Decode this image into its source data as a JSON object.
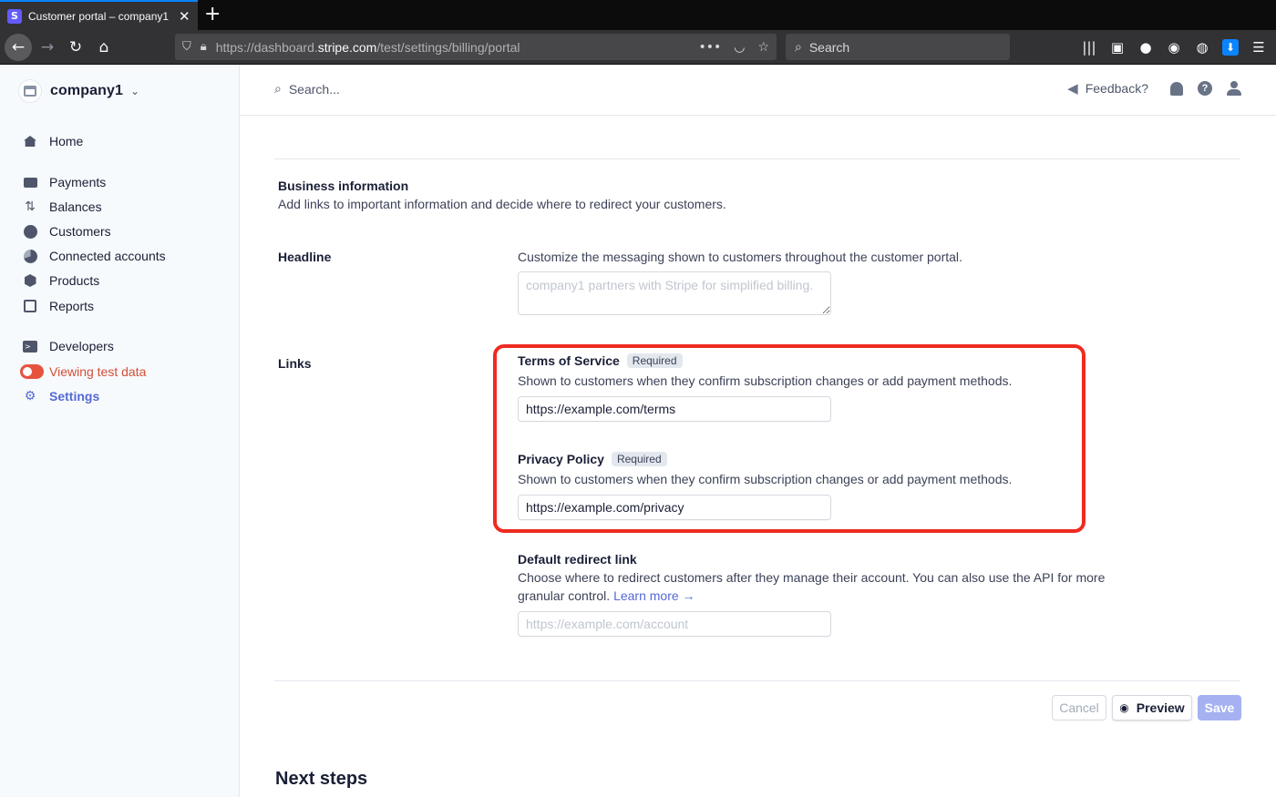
{
  "browser": {
    "tab_title": "Customer portal – company1 –",
    "url_prefix": "https://dashboard.",
    "url_domain": "stripe.com",
    "url_path": "/test/settings/billing/portal",
    "search_placeholder": "Search"
  },
  "account": {
    "name": "company1"
  },
  "sidebar": {
    "items": [
      {
        "label": "Home"
      },
      {
        "label": "Payments"
      },
      {
        "label": "Balances"
      },
      {
        "label": "Customers"
      },
      {
        "label": "Connected accounts"
      },
      {
        "label": "Products"
      },
      {
        "label": "Reports"
      },
      {
        "label": "Developers"
      },
      {
        "label": "Viewing test data"
      },
      {
        "label": "Settings"
      }
    ]
  },
  "topbar": {
    "search_label": "Search...",
    "feedback_label": "Feedback?"
  },
  "business": {
    "title": "Business information",
    "description": "Add links to important information and decide where to redirect your customers."
  },
  "headline": {
    "label": "Headline",
    "description": "Customize the messaging shown to customers throughout the customer portal.",
    "placeholder": "company1 partners with Stripe for simplified billing."
  },
  "links": {
    "label": "Links",
    "terms": {
      "title": "Terms of Service",
      "badge": "Required",
      "description": "Shown to customers when they confirm subscription changes or add payment methods.",
      "value": "https://example.com/terms"
    },
    "privacy": {
      "title": "Privacy Policy",
      "badge": "Required",
      "description": "Shown to customers when they confirm subscription changes or add payment methods.",
      "value": "https://example.com/privacy"
    },
    "redirect": {
      "title": "Default redirect link",
      "description": "Choose where to redirect customers after they manage their account. You can also use the API for more granular control.",
      "learn_more": "Learn more →",
      "placeholder": "https://example.com/account"
    }
  },
  "actions": {
    "cancel": "Cancel",
    "preview": "Preview",
    "save": "Save"
  },
  "next_steps": {
    "title": "Next steps"
  },
  "colors": {
    "accent": "#5469d4",
    "test_mode": "#d44e37",
    "highlight": "#ef2b21"
  }
}
